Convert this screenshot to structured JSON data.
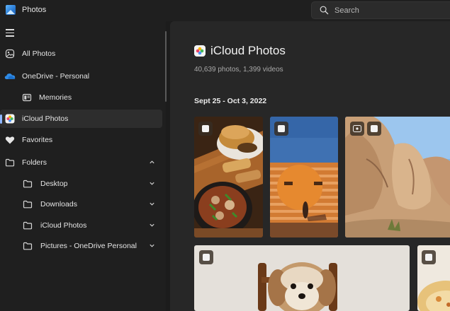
{
  "app": {
    "title": "Photos",
    "icon": "photos-app-icon"
  },
  "search": {
    "placeholder": "Search",
    "icon": "search-icon"
  },
  "sidebar": {
    "items": [
      {
        "label": "All Photos",
        "icon": "all-photos-icon"
      },
      {
        "label": "OneDrive - Personal",
        "icon": "onedrive-cloud-icon"
      },
      {
        "label": "Memories",
        "icon": "memories-icon"
      },
      {
        "label": "iCloud Photos",
        "icon": "icloud-photos-icon",
        "active": true
      },
      {
        "label": "Favorites",
        "icon": "heart-icon"
      },
      {
        "label": "Folders",
        "icon": "folder-icon",
        "expanded": true
      },
      {
        "label": "Desktop",
        "icon": "folder-icon"
      },
      {
        "label": "Downloads",
        "icon": "folder-icon"
      },
      {
        "label": "iCloud Photos",
        "icon": "folder-icon"
      },
      {
        "label": "Pictures - OneDrive Personal",
        "icon": "folder-icon"
      }
    ]
  },
  "main": {
    "title": "iCloud Photos",
    "subtitle": "40,639 photos, 1,399 videos",
    "date_header": "Sept 25 - Oct 3, 2022"
  },
  "colors": {
    "accent": "#8fb7ff",
    "background": "#1c1c1c",
    "panel": "#272727"
  }
}
